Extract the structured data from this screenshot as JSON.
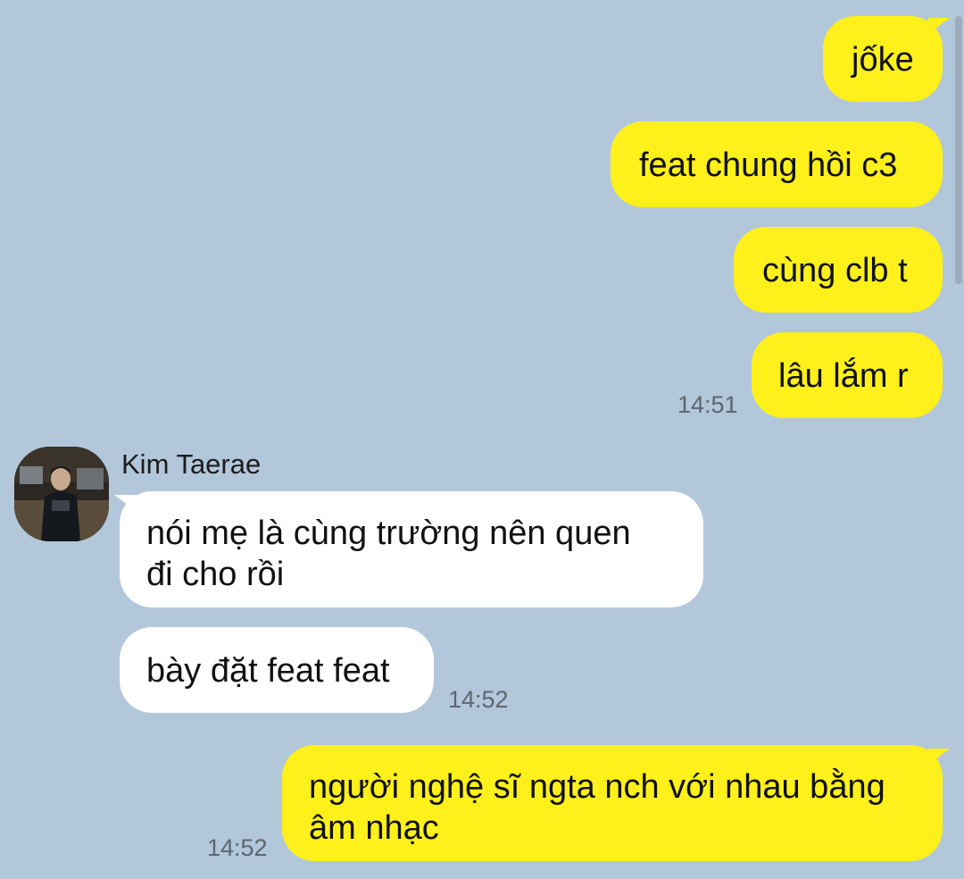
{
  "chat": {
    "contact_name": "Kim Taerae",
    "colors": {
      "background": "#b2c7da",
      "outgoing_bubble": "#fef01b",
      "incoming_bubble": "#ffffff"
    },
    "messages": [
      {
        "direction": "out",
        "text": "jốke"
      },
      {
        "direction": "out",
        "text": "feat chung hồi c3"
      },
      {
        "direction": "out",
        "text": "cùng clb t"
      },
      {
        "direction": "out",
        "text": "lâu lắm r",
        "time": "14:51"
      },
      {
        "direction": "in",
        "lines": [
          "nói mẹ là cùng trường nên quen",
          "đi cho rồi"
        ]
      },
      {
        "direction": "in",
        "text": "bày đặt feat feat",
        "time": "14:52"
      },
      {
        "direction": "out",
        "lines": [
          "người nghệ sĩ ngta nch với nhau bằng",
          "âm nhạc"
        ],
        "time": "14:52"
      }
    ]
  }
}
